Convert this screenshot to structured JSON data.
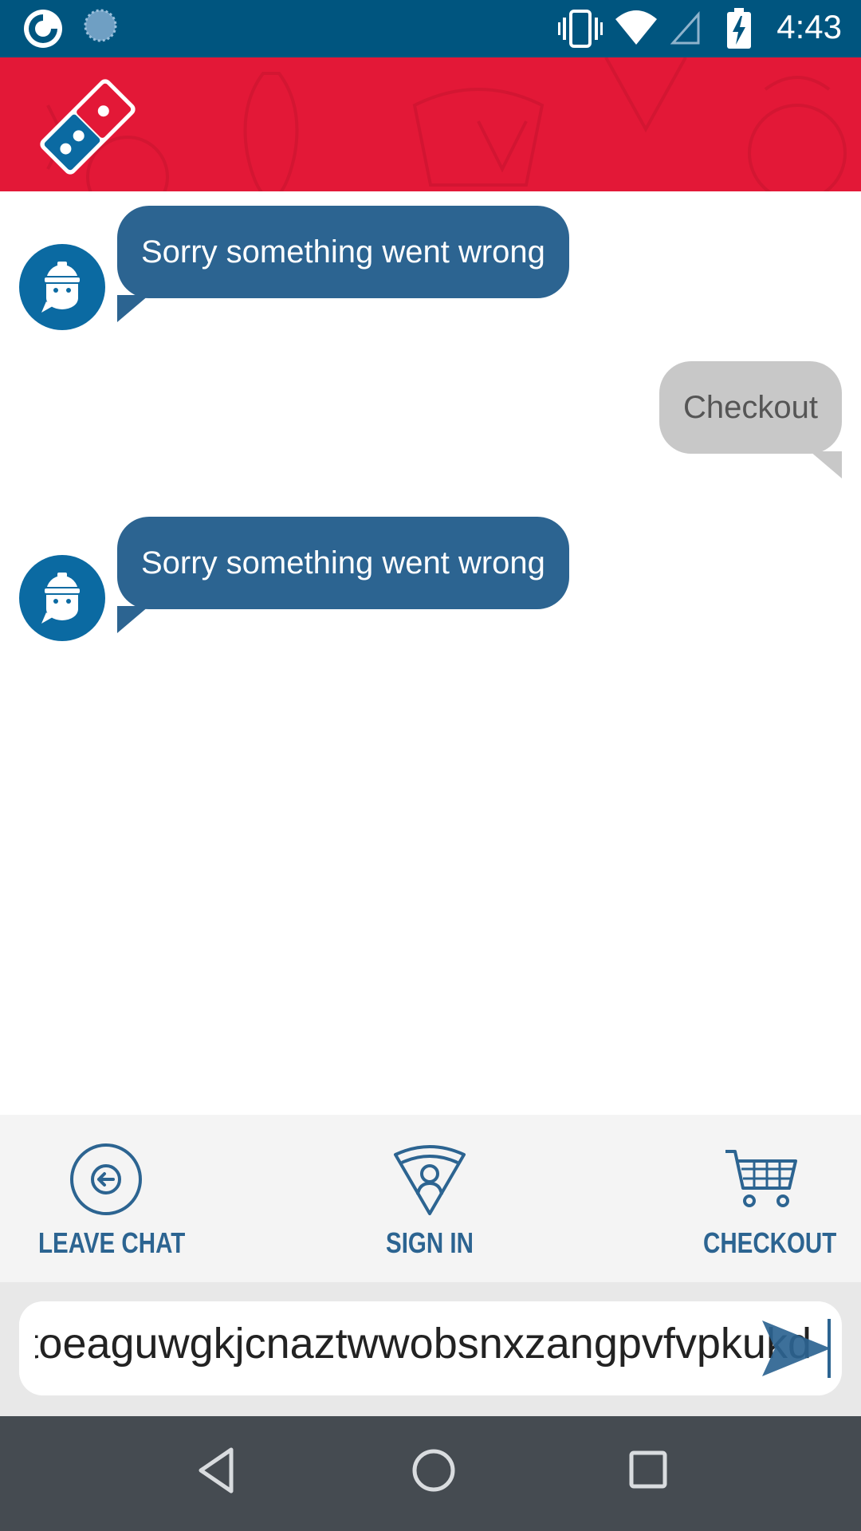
{
  "status_bar": {
    "time": "4:43",
    "icons": [
      "app-notification-icon",
      "sync-icon",
      "vibrate-icon",
      "wifi-icon",
      "signal-icon",
      "battery-charging-icon"
    ]
  },
  "header": {
    "logo": "dominos-logo",
    "brand_color": "#e31837"
  },
  "chat": {
    "messages": [
      {
        "sender": "bot",
        "text": "Sorry something went wrong"
      },
      {
        "sender": "user",
        "text": "Checkout"
      },
      {
        "sender": "bot",
        "text": "Sorry something went wrong"
      }
    ],
    "bot_color": "#2c6491",
    "user_color": "#c8c8c8"
  },
  "actions": {
    "leave_chat": {
      "label": "LEAVE CHAT",
      "icon": "arrow-left-circle-icon"
    },
    "sign_in": {
      "label": "SIGN IN",
      "icon": "pizza-slice-user-icon"
    },
    "checkout": {
      "label": "CHECKOUT",
      "icon": "cart-icon"
    }
  },
  "input": {
    "value": "ztoeaguwgkjcnaztwwobsnxzangpvfvpkukd",
    "send_icon": "send-icon"
  },
  "nav": {
    "back": "back-icon",
    "home": "home-icon",
    "recents": "recents-icon"
  }
}
